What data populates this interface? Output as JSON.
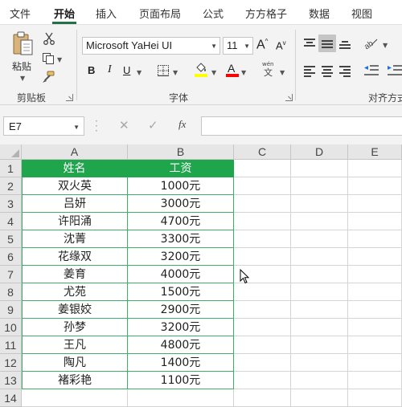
{
  "ribbon_tabs": [
    "文件",
    "开始",
    "插入",
    "页面布局",
    "公式",
    "方方格子",
    "数据",
    "视图"
  ],
  "active_tab": "开始",
  "clipboard": {
    "paste_label": "粘贴",
    "group_label": "剪贴板"
  },
  "font": {
    "group_label": "字体",
    "font_name": "Microsoft YaHei UI",
    "font_size": "11",
    "bold": "B",
    "italic": "I",
    "underline": "U",
    "grow": "A",
    "shrink": "A",
    "phonetic": "wén"
  },
  "alignment": {
    "group_label": "对齐方式"
  },
  "colors": {
    "accent": "#217346",
    "header_fill": "#1fa64d",
    "highlight_yellow": "#ffff00",
    "font_red": "#ff0000"
  },
  "formula_bar": {
    "name_box": "E7",
    "fx_label": "fx",
    "formula": ""
  },
  "columns": [
    "A",
    "B",
    "C",
    "D",
    "E"
  ],
  "rows": [
    "1",
    "2",
    "3",
    "4",
    "5",
    "6",
    "7",
    "8",
    "9",
    "10",
    "11",
    "12",
    "13",
    "14"
  ],
  "table": {
    "headers": [
      "姓名",
      "工资"
    ],
    "rows": [
      [
        "双火英",
        "1000元"
      ],
      [
        "吕妍",
        "3000元"
      ],
      [
        "许阳涌",
        "4700元"
      ],
      [
        "沈菁",
        "3300元"
      ],
      [
        "花缘双",
        "3200元"
      ],
      [
        "姜育",
        "4000元"
      ],
      [
        "尤苑",
        "1500元"
      ],
      [
        "姜银姣",
        "2900元"
      ],
      [
        "孙梦",
        "3200元"
      ],
      [
        "王凡",
        "4800元"
      ],
      [
        "陶凡",
        "1400元"
      ],
      [
        "褚彩艳",
        "1100元"
      ]
    ]
  }
}
